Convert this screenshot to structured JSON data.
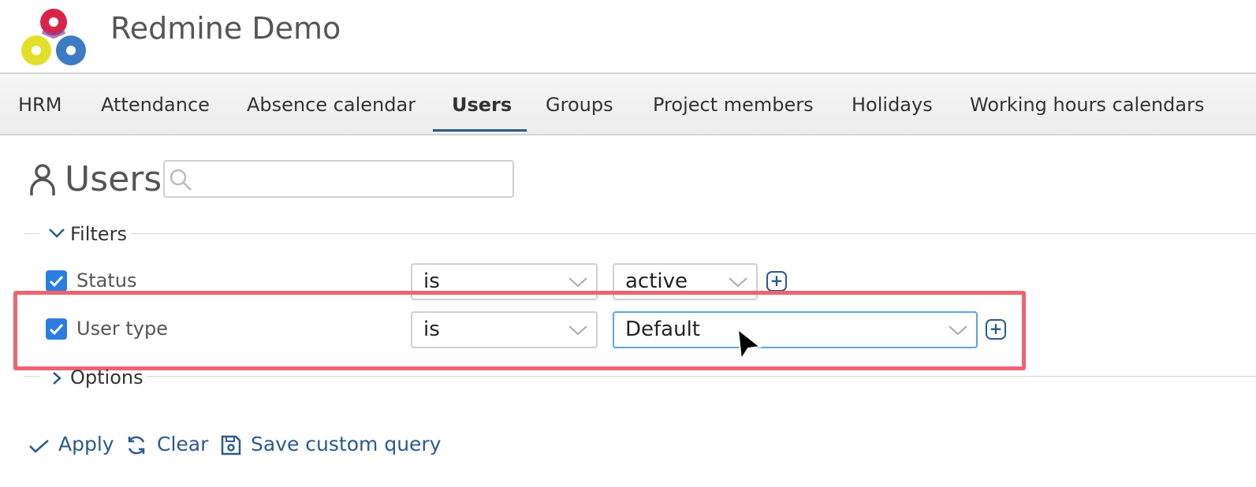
{
  "header": {
    "title": "Redmine Demo"
  },
  "menu": {
    "tabs": [
      {
        "label": "HRM"
      },
      {
        "label": "Attendance"
      },
      {
        "label": "Absence calendar"
      },
      {
        "label": "Users",
        "selected": true
      },
      {
        "label": "Groups"
      },
      {
        "label": "Project members"
      },
      {
        "label": "Holidays"
      },
      {
        "label": "Working hours calendars"
      }
    ]
  },
  "page": {
    "title": "Users",
    "search": {
      "value": "",
      "placeholder": ""
    }
  },
  "filters": {
    "legend": "Filters",
    "rows": [
      {
        "label": "Status",
        "checked": true,
        "operator": "is",
        "value": "active"
      },
      {
        "label": "User type",
        "checked": true,
        "operator": "is",
        "value": "Default"
      }
    ]
  },
  "options": {
    "legend": "Options"
  },
  "actions": {
    "apply": "Apply",
    "clear": "Clear",
    "save": "Save custom query"
  },
  "colors": {
    "link": "#2a5a8c",
    "checkbox": "#2b7de0",
    "highlight": "#ee6470",
    "focus_border": "#5fa3dc"
  },
  "icons": [
    "redmine-logo",
    "user-icon",
    "search-icon",
    "chevron-down-icon",
    "chevron-right-icon",
    "check-icon",
    "refresh-icon",
    "floppy-disk-icon",
    "plus-icon",
    "mouse-cursor-icon"
  ]
}
